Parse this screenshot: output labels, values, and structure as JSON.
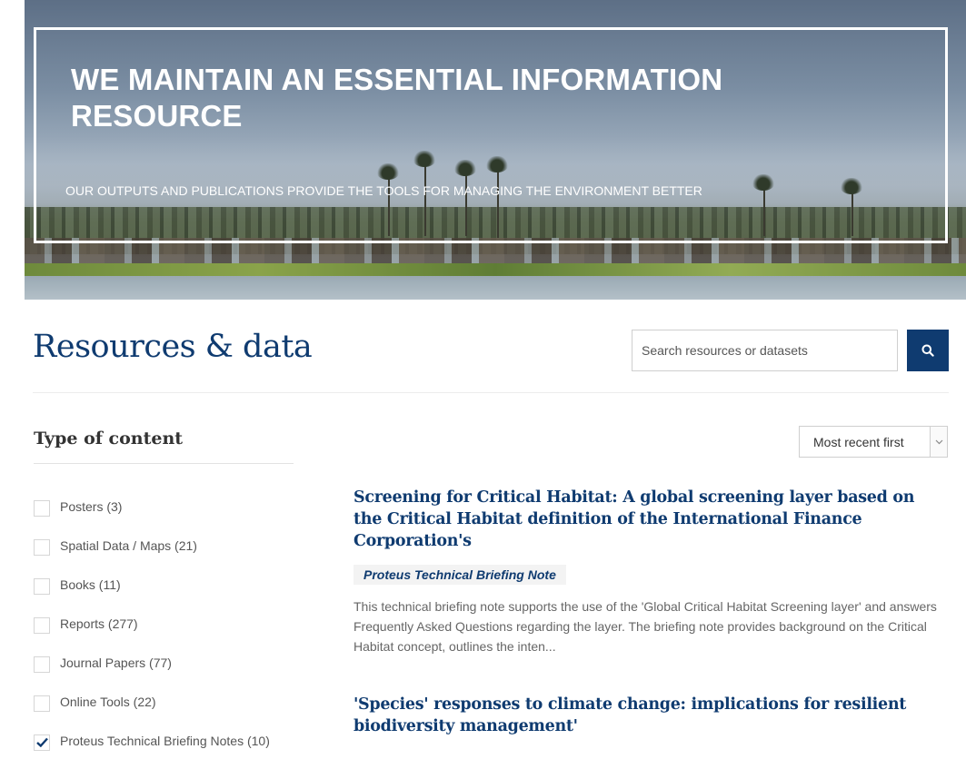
{
  "hero": {
    "title": "WE MAINTAIN AN ESSENTIAL INFORMATION RESOURCE",
    "subtitle": "OUR OUTPUTS AND PUBLICATIONS PROVIDE THE TOOLS FOR MANAGING THE ENVIRONMENT BETTER"
  },
  "header": {
    "title": "Resources & data",
    "search_placeholder": "Search resources or datasets",
    "search_icon": "search-icon"
  },
  "sidebar": {
    "heading": "Type of content",
    "items": [
      {
        "label": "Posters (3)",
        "checked": false
      },
      {
        "label": "Spatial Data / Maps (21)",
        "checked": false
      },
      {
        "label": "Books (11)",
        "checked": false
      },
      {
        "label": "Reports (277)",
        "checked": false
      },
      {
        "label": "Journal Papers (77)",
        "checked": false
      },
      {
        "label": "Online Tools (22)",
        "checked": false
      },
      {
        "label": "Proteus Technical Briefing Notes (10)",
        "checked": true
      }
    ]
  },
  "sort": {
    "selected": "Most recent first"
  },
  "results": [
    {
      "title": "Screening for Critical Habitat: A global screening layer based on the Critical Habitat definition of the International Finance Corporation's",
      "tag": "Proteus Technical Briefing Note",
      "description": "This technical briefing note supports the use of the 'Global Critical Habitat Screening layer' and answers Frequently Asked Questions regarding the layer. The briefing note provides background on the Critical Habitat concept, outlines the inten..."
    },
    {
      "title": "'Species' responses to climate change: implications for resilient biodiversity management'"
    }
  ],
  "colors": {
    "brand": "#0f3b70",
    "text_muted": "#666666"
  }
}
